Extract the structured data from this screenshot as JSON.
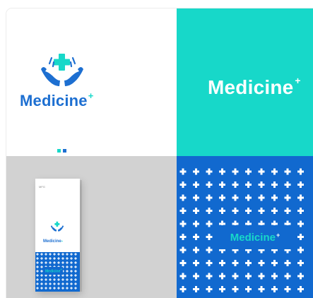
{
  "brand": {
    "name": "Medicine",
    "superscript": "+",
    "box_tag": "MFG"
  },
  "colors": {
    "primary_blue": "#1d6fd1",
    "pattern_blue": "#1169cf",
    "teal": "#17d8c9",
    "white": "#ffffff",
    "gray_background": "#d2d2d2"
  },
  "indicator_dots": [
    "#17d8c9",
    "#1d6fd1"
  ],
  "icons": {
    "logo": "hands-holding-cross-icon",
    "pattern": "plus-icon"
  }
}
